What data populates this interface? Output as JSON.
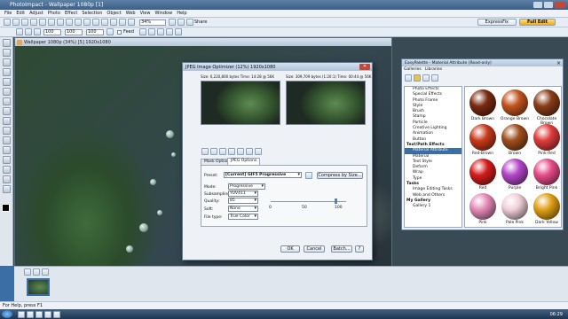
{
  "window": {
    "title": "PhotoImpact - Wallpaper 1080p [1]"
  },
  "menu": [
    "File",
    "Edit",
    "Adjust",
    "Photo",
    "Effect",
    "Selection",
    "Object",
    "Web",
    "View",
    "Window",
    "Help"
  ],
  "toolbar": {
    "zoom": "34%",
    "share": "Share",
    "mode_tabs": [
      "ExpressFix",
      "Full Edit"
    ]
  },
  "toolbar2": {
    "fields": [
      "100",
      "100",
      "100"
    ],
    "checkbox": "Feed"
  },
  "document": {
    "title": "Wallpaper 1080p (34%) [5] 1920x1080"
  },
  "dialog": {
    "title": "JPEG Image Optimizer (12%) 1920x1080",
    "size_left": "Size: 6,220,800 bytes Time: 14:28 @ 56K",
    "size_right": "Size: 309,709 bytes (1:20:1) Time: 00:44 @ 56K",
    "tabs": [
      "Mask Options",
      "JPEG Options"
    ],
    "preset_label": "Preset:",
    "preset_value": "[Current] GIF5 Progressive",
    "compress_btn": "Compress by Size...",
    "mode_label": "Mode:",
    "mode_value": "Progressive",
    "subsampling_label": "Subsampling:",
    "subsampling_value": "YUV411",
    "quality_label": "Quality:",
    "quality_value": "85",
    "soft_label": "Soft:",
    "soft_value": "None",
    "filetype_label": "File type:",
    "filetype_value": "True Color",
    "slider_ticks": [
      "0",
      "50",
      "100"
    ],
    "buttons": [
      "OK",
      "Cancel",
      "Batch...",
      "?"
    ]
  },
  "easypalette": {
    "title": "EasyPalette - Material Attribute (Read-only)",
    "tabs": [
      "Galleries",
      "Libraries"
    ],
    "tree": [
      {
        "label": "Photo Effects",
        "type": "item"
      },
      {
        "label": "Special Effects",
        "type": "item"
      },
      {
        "label": "Photo Frame",
        "type": "item"
      },
      {
        "label": "Style",
        "type": "item"
      },
      {
        "label": "Brush",
        "type": "item"
      },
      {
        "label": "Stamp",
        "type": "item"
      },
      {
        "label": "Particle",
        "type": "item"
      },
      {
        "label": "Creative Lighting",
        "type": "item"
      },
      {
        "label": "Animation",
        "type": "item"
      },
      {
        "label": "Button",
        "type": "item"
      },
      {
        "label": "Text/Path Effects",
        "type": "hdr"
      },
      {
        "label": "Material Attribute",
        "type": "on"
      },
      {
        "label": "Material",
        "type": "item"
      },
      {
        "label": "Text Style",
        "type": "item"
      },
      {
        "label": "Deform",
        "type": "item"
      },
      {
        "label": "Wrap",
        "type": "item"
      },
      {
        "label": "Type",
        "type": "item"
      },
      {
        "label": "Tasks",
        "type": "hdr"
      },
      {
        "label": "Image Editing Tasks",
        "type": "item"
      },
      {
        "label": "Web and Others",
        "type": "item"
      },
      {
        "label": "My Gallery",
        "type": "hdr"
      },
      {
        "label": "Gallery 1",
        "type": "item"
      }
    ],
    "swatches": [
      {
        "label": "Dark Brown",
        "color": "#7a2a12"
      },
      {
        "label": "Orange Brown",
        "color": "#c2541e"
      },
      {
        "label": "Chocolate Brown",
        "color": "#8a3c18"
      },
      {
        "label": "Red-Brown",
        "color": "#c83a1c"
      },
      {
        "label": "Brown",
        "color": "#a04e1e"
      },
      {
        "label": "Pink-Red",
        "color": "#e03c3c"
      },
      {
        "label": "Red",
        "color": "#d41c1c"
      },
      {
        "label": "Purple",
        "color": "#b447c8"
      },
      {
        "label": "Bright Pink",
        "color": "#e84c88"
      },
      {
        "label": "Pink",
        "color": "#e58ab8"
      },
      {
        "label": "Pale Pink",
        "color": "#f0cfd8"
      },
      {
        "label": "Dark Yellow",
        "color": "#e0a018"
      }
    ]
  },
  "status": {
    "text": "For Help, press F1"
  },
  "taskbar": {
    "time": "06:29"
  }
}
